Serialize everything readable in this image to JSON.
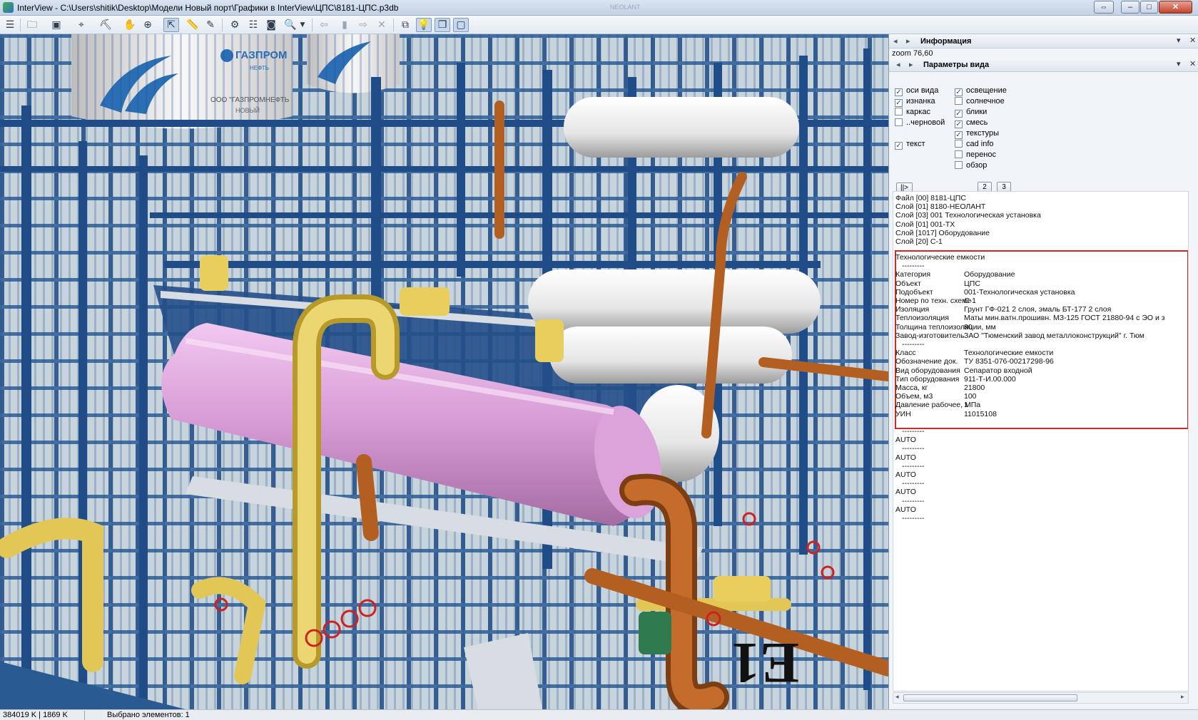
{
  "window": {
    "title": "InterView - C:\\Users\\shitik\\Desktop\\Модели Новый порт\\Графики в InterView\\ЦПС\\8181-ЦПС.p3db",
    "ghost_label": "NEOLANT",
    "close_label": "✕",
    "min_label": "–",
    "max_label": "□",
    "restore_left_label": "⇔"
  },
  "toolbar": {
    "icons": [
      "menu-icon",
      "open-file-icon",
      "image-icon",
      "target-icon",
      "paint-icon",
      "hand-pan-icon",
      "zoom-icon",
      "select-pointer-icon",
      "measure-ruler-icon",
      "pencil-icon",
      "settings-gear-icon",
      "layers-icon",
      "camera-icon",
      "search-zoom-icon",
      "dropdown-arrow-icon",
      "back-arrow-icon",
      "page-icon",
      "forward-arrow-icon",
      "close-x-icon",
      "box-view-icon",
      "light-bulb-icon",
      "copy-window-icon",
      "frame-icon"
    ]
  },
  "panel": {
    "info_title": "Информация",
    "zoom_text": "zoom 76,60",
    "view_params_title": "Параметры вида",
    "checkboxes_left": [
      {
        "label": "оси вида",
        "checked": true
      },
      {
        "label": "изнанка",
        "checked": true
      },
      {
        "label": "каркас",
        "checked": false
      },
      {
        "label": "..черновой",
        "checked": false
      },
      {
        "label": "текст",
        "checked": true
      }
    ],
    "checkboxes_right": [
      {
        "label": "освещение",
        "checked": true
      },
      {
        "label": "солнечное",
        "checked": false
      },
      {
        "label": "блики",
        "checked": true
      },
      {
        "label": "смесь",
        "checked": true
      },
      {
        "label": "текстуры",
        "checked": true
      },
      {
        "label": "cad info",
        "checked": false
      },
      {
        "label": "перенос",
        "checked": false
      },
      {
        "label": "обзор",
        "checked": false
      }
    ],
    "btn_play": "||>",
    "btn_2": "2",
    "btn_3": "3",
    "file_lines": [
      "Файл [00] 8181-ЦПС",
      "Слой [01] 8180-НЕОЛАНТ",
      "Слой [03] 001 Технологическая установка",
      "Слой [01] 001-ТХ",
      "Слой [1017] Оборудование",
      "Слой [20] С-1"
    ],
    "props_title": "Технологические емкости",
    "dashes": "---------",
    "props1": [
      {
        "k": "Категория",
        "v": "Оборудование"
      },
      {
        "k": "Объект",
        "v": "ЦПС"
      },
      {
        "k": "Подобъект",
        "v": "001-Технологическая установка"
      },
      {
        "k": "Номер по техн. схеме",
        "v": "С-1"
      },
      {
        "k": "Изоляция",
        "v": "Грунт ГФ-021 2 слоя, эмаль БТ-177 2 слоя"
      },
      {
        "k": "Теплоизоляция",
        "v": "Маты мин.ватн.прошивн. МЗ-125 ГОСТ 21880-94 с ЭО и з"
      },
      {
        "k": "Толщина теплоизоляции, мм",
        "v": "80"
      },
      {
        "k": "Завод-изготовитель",
        "v": "ЗАО \"Тюменский завод металлоконструкций\" г. Тюм"
      }
    ],
    "props2": [
      {
        "k": "Класс",
        "v": "Технологические емкости"
      },
      {
        "k": "Обозначение док.",
        "v": "ТУ 8351-076-00217298-96"
      },
      {
        "k": "Вид оборудования",
        "v": "Сепаратор входной"
      },
      {
        "k": "Тип оборудования",
        "v": "911-Т-И.00.000"
      },
      {
        "k": "Масса, кг",
        "v": "21800"
      },
      {
        "k": "Объем, м3",
        "v": "100"
      },
      {
        "k": "Давление рабочее, МПа",
        "v": "1"
      },
      {
        "k": "УИН",
        "v": "11015108"
      }
    ],
    "auto_label": "AUTO"
  },
  "status": {
    "memory": "384019 K | 1869 K",
    "selected": "Выбрано элементов: 1"
  },
  "scene": {
    "logo_text": "ГАЗПРОМ",
    "logo_sub": "НЕФТЬ",
    "tank_text": "ООО \"ГАЗПРОМНЕФТЬ",
    "tank_text2": "НОВЫЙ",
    "label_big": "E1"
  },
  "colors": {
    "steel": "#1f4c86",
    "pink_vessel": "#d79ad6",
    "white_vessel": "#eeeeee",
    "yellow_pipe": "#e6c94e",
    "orange_pipe": "#b45f22",
    "frame_red": "#c62c2c"
  }
}
